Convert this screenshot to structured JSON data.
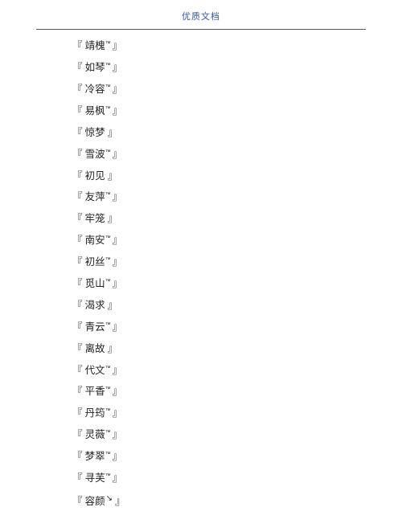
{
  "header": {
    "title": "优质文档"
  },
  "items": [
    {
      "name": "靖槐",
      "mark": "tm"
    },
    {
      "name": "如琴",
      "mark": "tm"
    },
    {
      "name": "冷容",
      "mark": "tm"
    },
    {
      "name": "易枫",
      "mark": "tm"
    },
    {
      "name": "惊梦",
      "mark": "none"
    },
    {
      "name": "雪波",
      "mark": "tm"
    },
    {
      "name": "初见",
      "mark": "none"
    },
    {
      "name": "友萍",
      "mark": "tm"
    },
    {
      "name": "牢笼",
      "mark": "none"
    },
    {
      "name": "南安",
      "mark": "tm"
    },
    {
      "name": "初丝",
      "mark": "tm"
    },
    {
      "name": "觅山",
      "mark": "tm"
    },
    {
      "name": "渴求",
      "mark": "none"
    },
    {
      "name": "青云",
      "mark": "tm"
    },
    {
      "name": "离故",
      "mark": "none"
    },
    {
      "name": "代文",
      "mark": "tm"
    },
    {
      "name": "平香",
      "mark": "tm"
    },
    {
      "name": "丹筠",
      "mark": "tm"
    },
    {
      "name": "灵薇",
      "mark": "tm"
    },
    {
      "name": "梦翠",
      "mark": "tm"
    },
    {
      "name": "寻芙",
      "mark": "tm"
    },
    {
      "name": "容颜",
      "mark": "tail"
    }
  ],
  "brackets": {
    "open": "『",
    "close": "』"
  },
  "marks": {
    "tm": "™",
    "tail": "↘"
  }
}
